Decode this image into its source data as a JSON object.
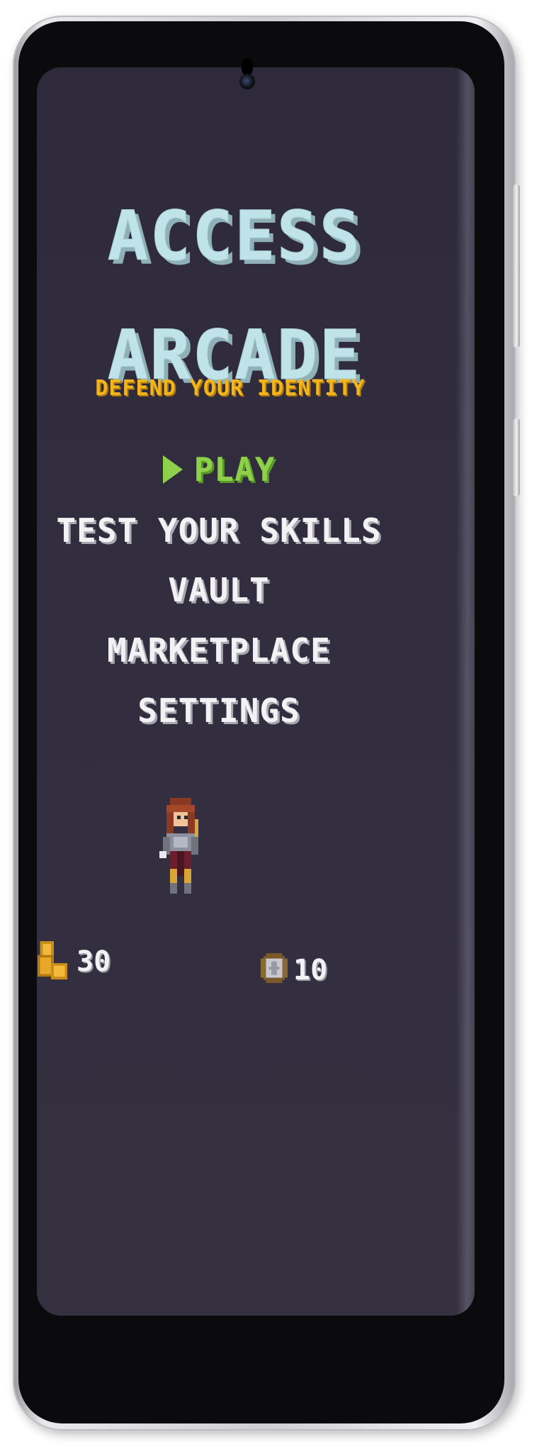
{
  "game": {
    "title_line1": "ACCESS",
    "title_line2": "ARCADE",
    "subtitle": "DEFEND YOUR IDENTITY"
  },
  "menu": {
    "play": "PLAY",
    "test_skills": "TEST YOUR SKILLS",
    "vault": "VAULT",
    "marketplace": "MARKETPLACE",
    "settings": "SETTINGS"
  },
  "stats": {
    "coins": "30",
    "shields": "10"
  },
  "colors": {
    "background": "#322e40",
    "title": "#bfe3e8",
    "subtitle": "#f2b51c",
    "selected_menu": "#8ed04a",
    "menu_text": "#f2f2f4"
  },
  "icons": {
    "coins": "coin-stack-icon",
    "shields": "shield-icon",
    "selector": "play-arrow-icon",
    "character": "warrior-character"
  }
}
